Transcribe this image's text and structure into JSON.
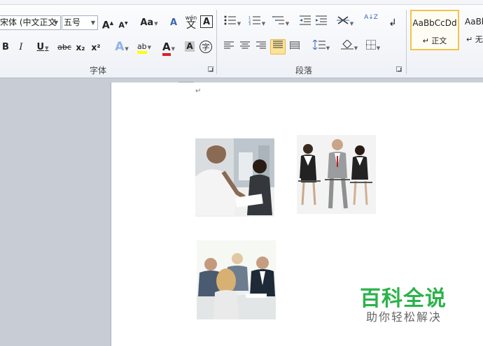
{
  "font": {
    "font_name": "宋体 (中文正文",
    "font_size": "五号",
    "grow_font": "A",
    "shrink_font": "A",
    "change_case": "Aa",
    "clear_format": "A",
    "phonetic": "wén",
    "phonetic_char": "文",
    "char_border": "A",
    "bold": "B",
    "italic": "I",
    "underline": "U",
    "strikethrough": "abc",
    "subscript": "x₂",
    "superscript": "x²",
    "text_effect": "A",
    "highlight": "ab",
    "font_color": "A",
    "char_shading": "A",
    "enclose": "字",
    "group_label": "字体"
  },
  "paragraph": {
    "group_label": "段落",
    "sort_label": "A↓Z"
  },
  "styles": {
    "normal_sample": "AaBbCcDd",
    "normal_name": "↵ 正文",
    "nospacing_sample": "AaBb",
    "nospacing_name": "↵ 无"
  },
  "document": {
    "para_mark": "↵"
  },
  "watermark": {
    "title": "百科全说",
    "subtitle": "助你轻松解决"
  },
  "colors": {
    "highlight_yellow": "#ffff00",
    "font_red": "#e02020",
    "active_button": "#fbe39a",
    "brand_green": "#2bb34a"
  }
}
